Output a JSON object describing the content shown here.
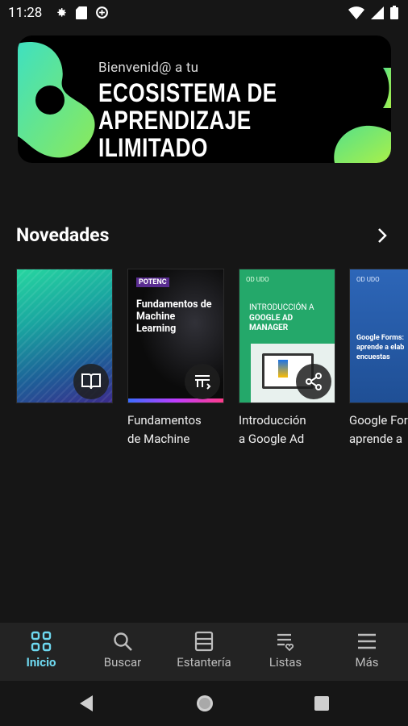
{
  "status": {
    "time": "11:28"
  },
  "banner": {
    "subtitle": "Bienvenid@ a tu",
    "title_line1": "ECOSISTEMA DE",
    "title_line2": "APRENDIZAJE ILIMITADO"
  },
  "section": {
    "title": "Novedades"
  },
  "books": [
    {
      "title_line1": "",
      "title_line2": "",
      "badge": "book-icon"
    },
    {
      "title_line1": "Fundamentos",
      "title_line2": "de Machine",
      "cover_title": "Fundamentos de Machine Learning",
      "cover_brand": "POTENC",
      "badge": "course-icon"
    },
    {
      "title_line1": "Introducción",
      "title_line2": "a Google Ad",
      "cover_title": "INTRODUCCIÓN A",
      "cover_title2": "GOOGLE AD",
      "cover_title3": "MANAGER",
      "cover_brand": "OD UDO",
      "badge": "share-icon"
    },
    {
      "title_line1": "Google For",
      "title_line2": "aprende a",
      "cover_title": "Google Forms:",
      "cover_title2": "aprende a elab",
      "cover_title3": "encuestas",
      "cover_brand": "OD UDO"
    }
  ],
  "nav": [
    {
      "label": "Inicio",
      "icon": "home-grid-icon",
      "active": true
    },
    {
      "label": "Buscar",
      "icon": "search-icon"
    },
    {
      "label": "Estantería",
      "icon": "shelf-icon"
    },
    {
      "label": "Listas",
      "icon": "lists-icon"
    },
    {
      "label": "Más",
      "icon": "menu-icon"
    }
  ],
  "colors": {
    "accent": "#6ed8ef",
    "green": "#7be06c",
    "background": "#161616"
  }
}
